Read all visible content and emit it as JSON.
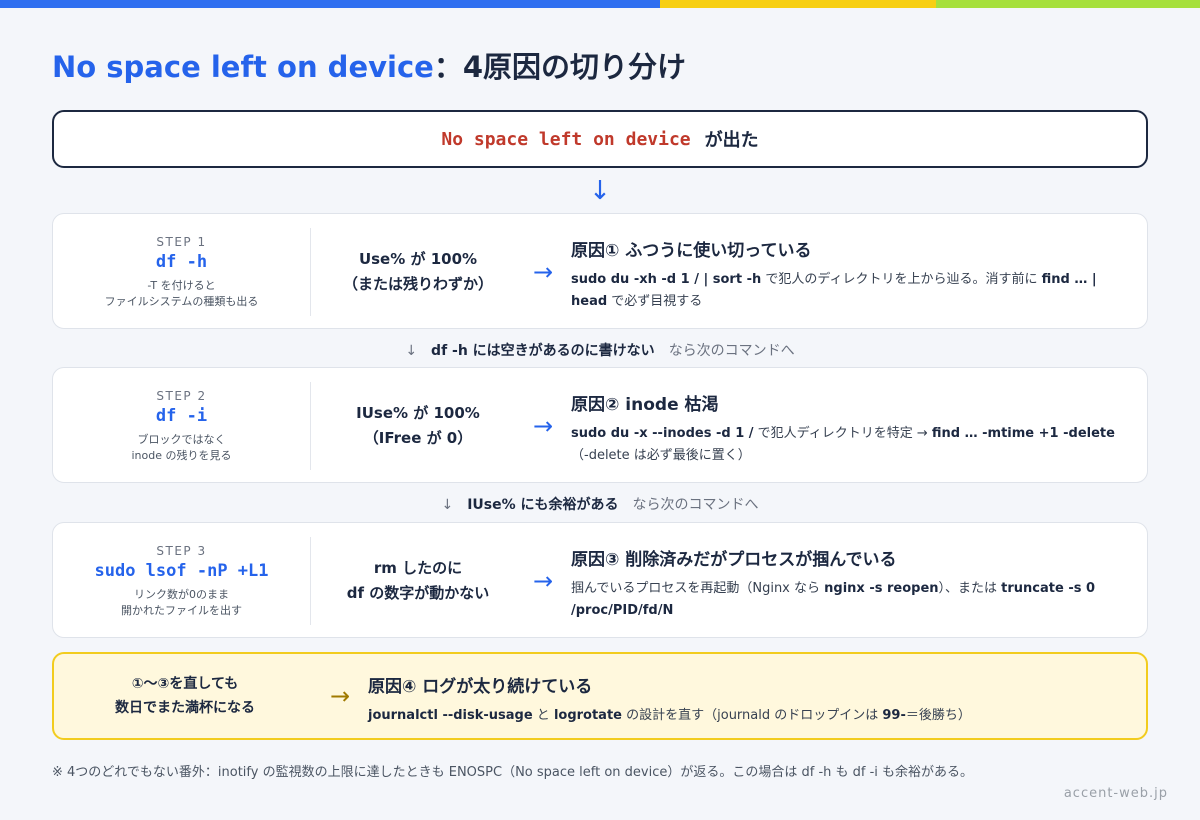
{
  "title": {
    "main": "No space left on device",
    "sub": "：4原因の切り分け"
  },
  "trigger": {
    "code": "No space left on device",
    "text": "が出た"
  },
  "flow_arrow": "↓",
  "steps": [
    {
      "label": "STEP 1",
      "command": "df -h",
      "note_line1": "-T を付けると",
      "note_line2": "ファイルシステムの種類も出る",
      "cond_line1": "Use% が 100%",
      "cond_line2": "（または残りわずか）",
      "arrow": "→",
      "cause": "原因① ふつうに使い切っている",
      "fix": [
        {
          "t": "sudo du -xh -d 1 / | sort -h",
          "b": true
        },
        {
          "t": " で犯人のディレクトリを上から辿る。消す前に ",
          "b": false
        },
        {
          "t": "find …",
          "b": true
        },
        {
          "t": " | head",
          "b": true
        },
        {
          "t": " で必ず目視する",
          "b": false
        }
      ]
    },
    {
      "label": "STEP 2",
      "command": "df -i",
      "note_line1": "ブロックではなく",
      "note_line2": "inode の残りを見る",
      "cond_line1": "IUse% が 100%",
      "cond_line2": "（IFree が 0）",
      "arrow": "→",
      "cause": "原因② inode 枯渇",
      "fix": [
        {
          "t": "sudo du -x --inodes -d 1 /",
          "b": true
        },
        {
          "t": " で犯人ディレクトリを特定 → ",
          "b": false
        },
        {
          "t": "find … -mtime +1 -delete",
          "b": true
        },
        {
          "t": "（-delete は必ず最後に置く）",
          "b": false
        }
      ]
    },
    {
      "label": "STEP 3",
      "command": "sudo lsof -nP +L1",
      "note_line1": "リンク数が0のまま",
      "note_line2": "開かれたファイルを出す",
      "cond_line1": "rm したのに",
      "cond_line2": "df の数字が動かない",
      "arrow": "→",
      "cause": "原因③ 削除済みだがプロセスが掴んでいる",
      "fix": [
        {
          "t": "掴んでいるプロセスを再起動（Nginx なら ",
          "b": false
        },
        {
          "t": "nginx -s reopen",
          "b": true
        },
        {
          "t": "）、または ",
          "b": false
        },
        {
          "t": "truncate -s 0 /proc/PID/fd/N",
          "b": true
        }
      ]
    }
  ],
  "between": [
    {
      "arrow": "↓",
      "bold": "df -h には空きがあるのに書けない",
      "rest": "なら次のコマンドへ"
    },
    {
      "arrow": "↓",
      "bold": "IUse% にも余裕がある",
      "rest": "なら次のコマンドへ"
    }
  ],
  "final": {
    "line1": "①〜③を直しても",
    "line2": "数日でまた満杯になる",
    "arrow": "→",
    "cause": "原因④ ログが太り続けている",
    "fix": [
      {
        "t": "journalctl --disk-usage",
        "b": true
      },
      {
        "t": " と ",
        "b": false
      },
      {
        "t": "logrotate",
        "b": true
      },
      {
        "t": " の設計を直す（journald のドロップインは ",
        "b": false
      },
      {
        "t": "99-",
        "b": true
      },
      {
        "t": "＝後勝ち）",
        "b": false
      }
    ]
  },
  "footnote": "※ 4つのどれでもない番外：inotify の監視数の上限に達したときも ENOSPC（No space left on device）が返る。この場合は df -h も df -i も余裕がある。",
  "watermark": "accent-web.jp",
  "colors": {
    "accent": "#2563eb",
    "error_code": "#c0392b",
    "highlight_bg": "#fff8dd",
    "highlight_border": "#f2cc1e"
  }
}
